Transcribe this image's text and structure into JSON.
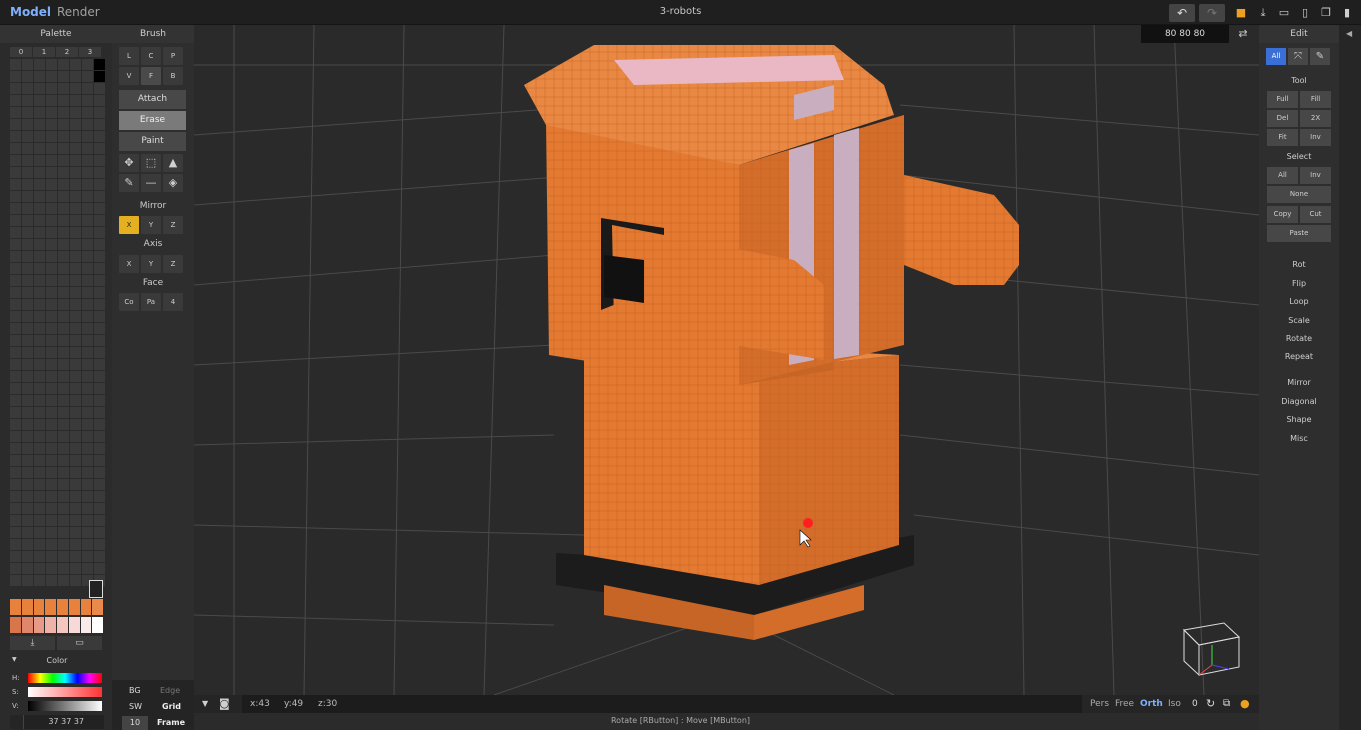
{
  "topbar": {
    "mode_model": "Model",
    "mode_render": "Render",
    "file_title": "3-robots"
  },
  "palette": {
    "title": "Palette",
    "tabs": [
      "0",
      "1",
      "2",
      "3"
    ],
    "swatch_row1": [
      "#e8813b",
      "#e8813b",
      "#e8813b",
      "#e8813b",
      "#e8813b",
      "#e8813b",
      "#e8813b",
      "#e98a4a"
    ],
    "swatch_row2": [
      "#d9754b",
      "#e0876b",
      "#e89a86",
      "#efb3a7",
      "#f3c7c0",
      "#f6dad7",
      "#f8ebe9",
      "#ffffff"
    ],
    "color_title": "Color",
    "hsv": [
      "H:",
      "S:",
      "V:"
    ],
    "rgb_value": "37 37 37"
  },
  "brush": {
    "title": "Brush",
    "modes_row1": [
      "L",
      "C",
      "P"
    ],
    "modes_row2": [
      "V",
      "F",
      "B"
    ],
    "attach": "Attach",
    "erase": "Erase",
    "paint": "Paint",
    "mirror_title": "Mirror",
    "mirror": [
      "X",
      "Y",
      "Z"
    ],
    "axis_title": "Axis",
    "axis": [
      "X",
      "Y",
      "Z"
    ],
    "face_title": "Face",
    "face": [
      "Co",
      "Pa",
      "4"
    ]
  },
  "bottom_left": {
    "bg": "BG",
    "edge": "Edge",
    "sw": "SW",
    "grid": "Grid",
    "size": "10",
    "frame": "Frame"
  },
  "viewport": {
    "size": "80  80  80",
    "coords": {
      "x": "x:43",
      "y": "y:49",
      "z": "z:30"
    },
    "view_modes": [
      "Pers",
      "Free",
      "Orth",
      "Iso"
    ],
    "active_view_mode": "Orth",
    "zero": "0",
    "hint": "Rotate [RButton] : Move [MButton]"
  },
  "edit": {
    "title": "Edit",
    "tabs": [
      "All"
    ],
    "tool_title": "Tool",
    "tool": [
      "Full",
      "Fill",
      "Del",
      "2X",
      "Fit",
      "Inv"
    ],
    "select_title": "Select",
    "select": [
      "All",
      "Inv"
    ],
    "none": "None",
    "copy": "Copy",
    "cut": "Cut",
    "paste": "Paste",
    "ops": [
      "Rot",
      "Flip",
      "Loop",
      "Scale",
      "Rotate",
      "Repeat"
    ],
    "ops2": [
      "Mirror",
      "Diagonal",
      "Shape",
      "Misc"
    ]
  },
  "colors": {
    "orange": "#e47a32",
    "orange_dark": "#b85a1f",
    "accent_yellow": "#e4b020",
    "accent_blue": "#7fb0ff",
    "stripe": "#c9aec0"
  }
}
